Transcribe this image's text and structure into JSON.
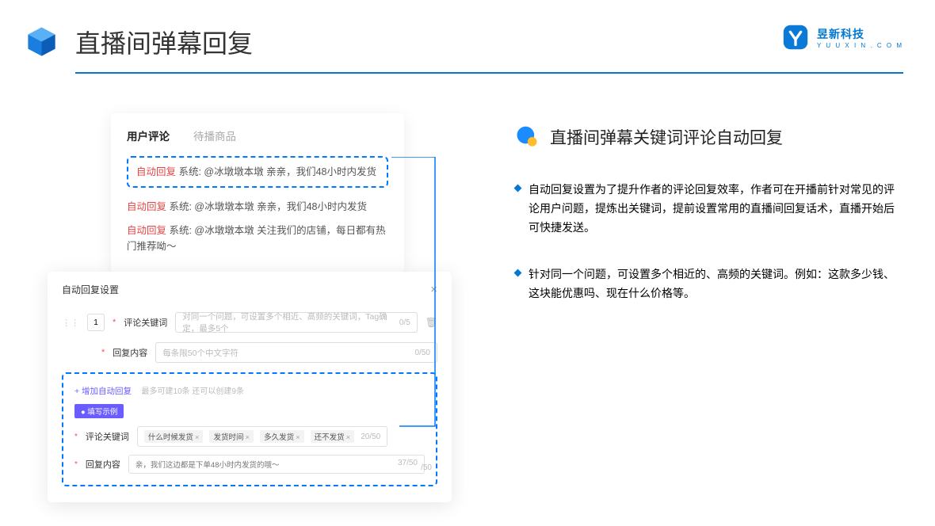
{
  "header": {
    "title": "直播间弹幕回复",
    "brand_name": "昱新科技",
    "brand_sub": "Y U U X I N . C O M"
  },
  "comments": {
    "tab_active": "用户评论",
    "tab_inactive": "待播商品",
    "highlighted": {
      "tag": "自动回复",
      "text": " 系统: @冰墩墩本墩 亲亲，我们48小时内发货"
    },
    "lines": [
      {
        "tag": "自动回复",
        "text": " 系统: @冰墩墩本墩 亲亲，我们48小时内发货"
      },
      {
        "tag": "自动回复",
        "text": " 系统: @冰墩墩本墩 关注我们的店铺，每日都有热门推荐呦～"
      }
    ]
  },
  "settings": {
    "title": "自动回复设置",
    "seq": "1",
    "row1": {
      "label": "评论关键词",
      "placeholder": "对同一个问题，可设置多个相近、高频的关键词，Tag确定，最多5个",
      "counter": "0/5"
    },
    "row2": {
      "label": "回复内容",
      "placeholder": "每条限50个中文字符",
      "counter": "0/50"
    },
    "add_link": "+ 增加自动回复",
    "add_hint": "最多可建10条 还可以创建9条",
    "example_badge": "● 填写示例",
    "ex1": {
      "label": "评论关键词",
      "tags": [
        "什么时候发货",
        "发货时间",
        "多久发货",
        "还不发货"
      ],
      "counter": "20/50"
    },
    "ex2": {
      "label": "回复内容",
      "text": "亲，我们这边都是下单48小时内发货的哦～",
      "counter": "37/50"
    },
    "stray": "/50"
  },
  "right": {
    "heading": "直播间弹幕关键词评论自动回复",
    "bullets": [
      "自动回复设置为了提升作者的评论回复效率，作者可在开播前针对常见的评论用户问题，提炼出关键词，提前设置常用的直播间回复话术，直播开始后可快捷发送。",
      "针对同一个问题，可设置多个相近的、高频的关键词。例如：这款多少钱、这块能优惠吗、现在什么价格等。"
    ]
  }
}
